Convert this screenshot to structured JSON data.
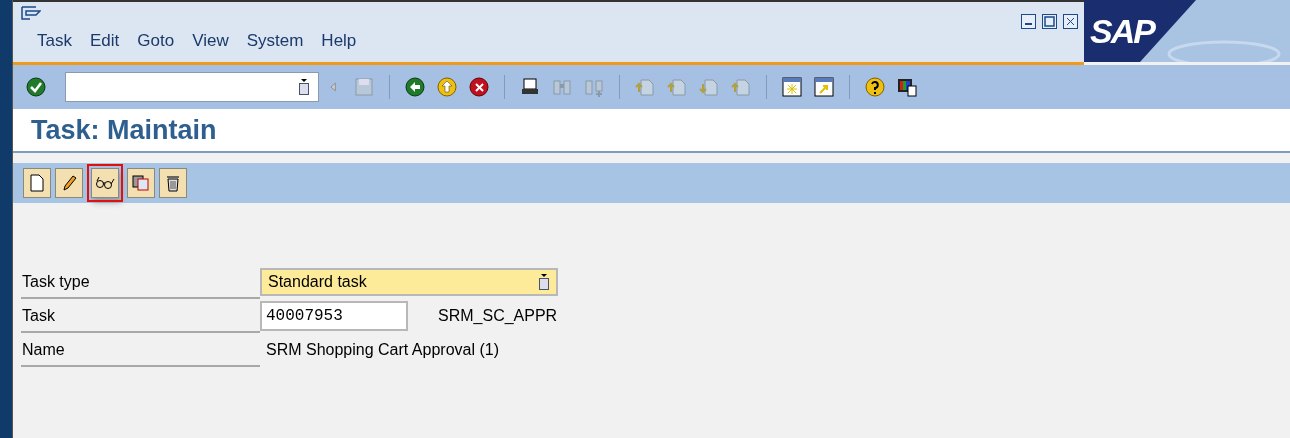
{
  "menu": [
    "Task",
    "Edit",
    "Goto",
    "View",
    "System",
    "Help"
  ],
  "logo": "SAP",
  "title": "Task: Maintain",
  "app_toolbar": [
    {
      "kind": "create",
      "highlighted": false
    },
    {
      "kind": "change",
      "highlighted": false
    },
    {
      "kind": "display",
      "highlighted": true
    },
    {
      "kind": "copy",
      "highlighted": false
    },
    {
      "kind": "delete",
      "highlighted": false
    }
  ],
  "form": [
    {
      "label": "Task type",
      "kind": "dropdown",
      "value": "Standard task"
    },
    {
      "label": "Task",
      "kind": "input",
      "value": "40007953",
      "extra": "SRM_SC_APPR"
    },
    {
      "label": "Name",
      "kind": "text",
      "value": "SRM Shopping Cart Approval (1)"
    }
  ]
}
